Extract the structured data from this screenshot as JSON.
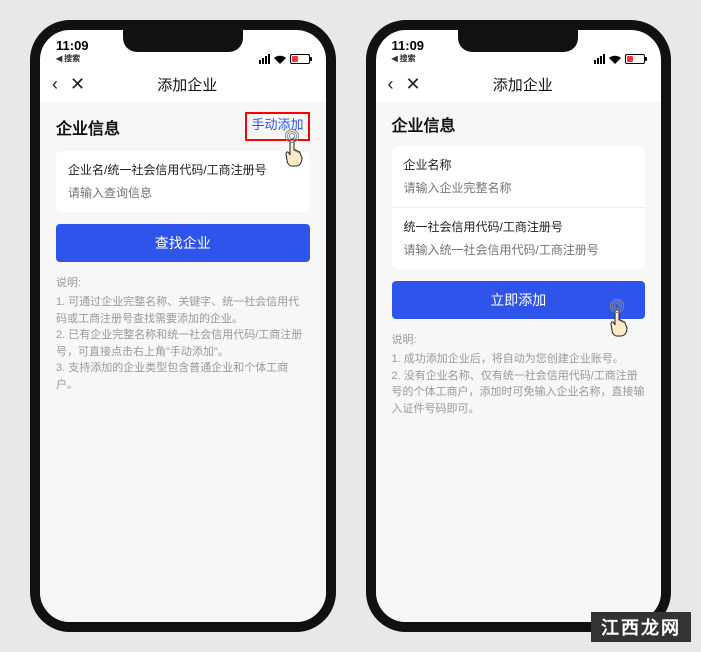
{
  "status": {
    "time": "11:09",
    "search": "搜索"
  },
  "nav": {
    "title": "添加企业"
  },
  "left": {
    "section_title": "企业信息",
    "manual_add": "手动添加",
    "field_label": "企业名/统一社会信用代码/工商注册号",
    "placeholder": "请输入查询信息",
    "button": "查找企业",
    "hint_label": "说明:",
    "hints": [
      "1. 可通过企业完整名称、关键字、统一社会信用代码或工商注册号查找需要添加的企业。",
      "2. 已有企业完整名称和统一社会信用代码/工商注册号，可直接点击右上角\"手动添加\"。",
      "3. 支持添加的企业类型包含普通企业和个体工商户。"
    ]
  },
  "right": {
    "section_title": "企业信息",
    "field1_label": "企业名称",
    "field1_placeholder": "请输入企业完整名称",
    "field2_label": "统一社会信用代码/工商注册号",
    "field2_placeholder": "请输入统一社会信用代码/工商注册号",
    "button": "立即添加",
    "hint_label": "说明:",
    "hints": [
      "1. 成功添加企业后，将自动为您创建企业账号。",
      "2. 没有企业名称、仅有统一社会信用代码/工商注册号的个体工商户，添加时可免输入企业名称，直接输入证件号码即可。"
    ]
  },
  "watermark": "江西龙网"
}
